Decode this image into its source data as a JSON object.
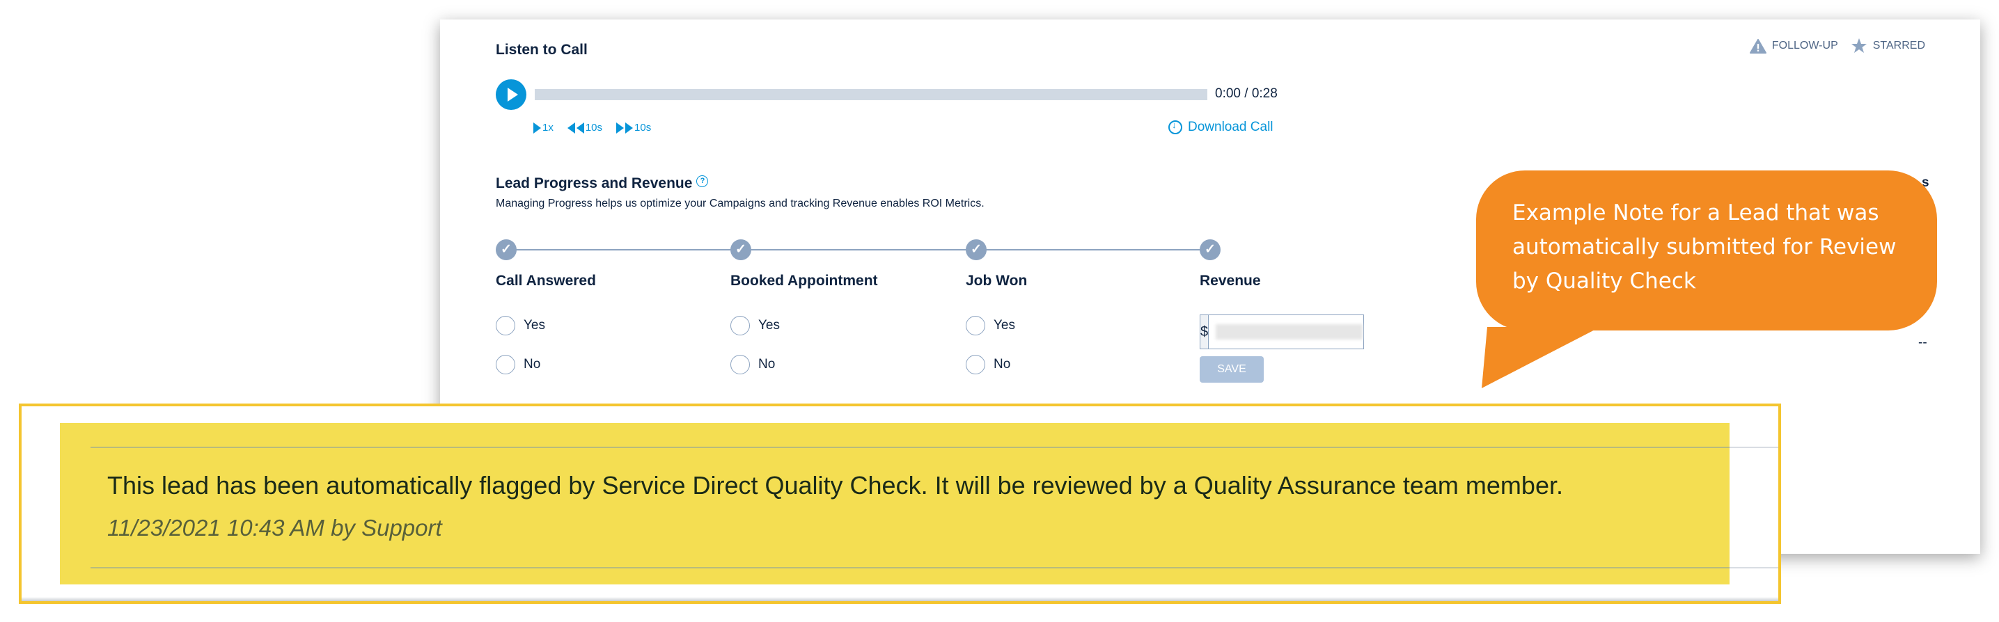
{
  "header": {
    "title": "Listen to Call",
    "flags": [
      {
        "icon": "warning-icon",
        "label": "FOLLOW-UP"
      },
      {
        "icon": "star-icon",
        "label": "STARRED"
      }
    ]
  },
  "player": {
    "time": "0:00 / 0:28",
    "progress_fraction": 0,
    "speed_label": "1x",
    "rewind_label": "10s",
    "forward_label": "10s",
    "download_label": "Download Call"
  },
  "lead_progress": {
    "title": "Lead Progress and Revenue",
    "help": "?",
    "subtitle": "Managing Progress helps us optimize your Campaigns and tracking Revenue enables ROI Metrics.",
    "steps": [
      {
        "label": "Call Answered",
        "options": [
          "Yes",
          "No"
        ]
      },
      {
        "label": "Booked Appointment",
        "options": [
          "Yes",
          "No"
        ]
      },
      {
        "label": "Job Won",
        "options": [
          "Yes",
          "No"
        ]
      },
      {
        "label": "Revenue"
      }
    ],
    "revenue": {
      "currency": "$",
      "value": "",
      "save_label": "SAVE"
    }
  },
  "right_partial": {
    "heading_fragment": "s",
    "value": "--"
  },
  "callout": {
    "text": "Example Note for a Lead that was automatically submitted for Review by Quality Check",
    "color": "#f38b22"
  },
  "note": {
    "text": "This lead has been automatically flagged by Service Direct Quality Check. It will be reviewed by a Quality Assurance team member.",
    "meta": "11/23/2021 10:43 AM by Support",
    "highlight_color": "#f4de52",
    "border_color": "#f4c52f"
  }
}
